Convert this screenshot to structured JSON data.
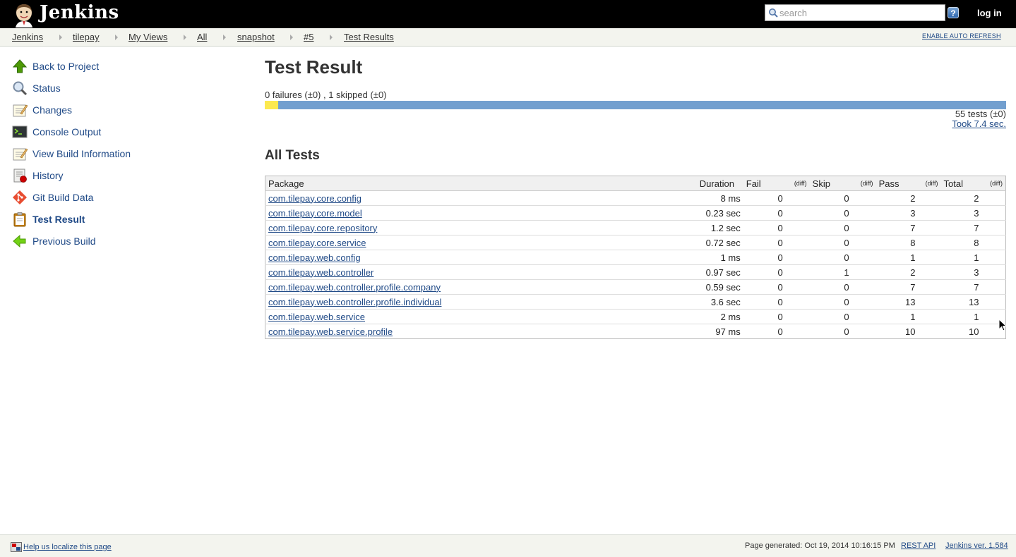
{
  "header": {
    "brand": "Jenkins",
    "search_placeholder": "search",
    "help_label": "?",
    "login_label": "log in"
  },
  "breadcrumbs": [
    "Jenkins",
    "tilepay",
    "My Views",
    "All",
    "snapshot",
    "#5",
    "Test Results"
  ],
  "auto_refresh_label": "ENABLE AUTO REFRESH",
  "side_panel": [
    {
      "label": "Back to Project",
      "icon": "up-arrow-icon"
    },
    {
      "label": "Status",
      "icon": "magnifier-icon"
    },
    {
      "label": "Changes",
      "icon": "notepad-icon"
    },
    {
      "label": "Console Output",
      "icon": "terminal-icon"
    },
    {
      "label": "View Build Information",
      "icon": "notepad-icon"
    },
    {
      "label": "History",
      "icon": "history-icon"
    },
    {
      "label": "Git Build Data",
      "icon": "git-icon"
    },
    {
      "label": "Test Result",
      "icon": "clipboard-icon"
    },
    {
      "label": "Previous Build",
      "icon": "left-arrow-icon"
    }
  ],
  "main": {
    "title": "Test Result",
    "summary": "0 failures (±0) , 1 skipped (±0)",
    "progress": {
      "total": 55,
      "failed": 0,
      "skipped": 1
    },
    "tests_count": "55 tests (±0)",
    "took": "Took 7.4 sec.",
    "all_tests_heading": "All Tests",
    "columns": {
      "package": "Package",
      "duration": "Duration",
      "fail": "Fail",
      "fail_diff": "(diff)",
      "skip": "Skip",
      "skip_diff": "(diff)",
      "pass": "Pass",
      "pass_diff": "(diff)",
      "total": "Total",
      "total_diff": "(diff)"
    },
    "rows": [
      {
        "package": "com.tilepay.core.config",
        "duration": "8 ms",
        "fail": "0",
        "skip": "0",
        "pass": "2",
        "total": "2"
      },
      {
        "package": "com.tilepay.core.model",
        "duration": "0.23 sec",
        "fail": "0",
        "skip": "0",
        "pass": "3",
        "total": "3"
      },
      {
        "package": "com.tilepay.core.repository",
        "duration": "1.2 sec",
        "fail": "0",
        "skip": "0",
        "pass": "7",
        "total": "7"
      },
      {
        "package": "com.tilepay.core.service",
        "duration": "0.72 sec",
        "fail": "0",
        "skip": "0",
        "pass": "8",
        "total": "8"
      },
      {
        "package": "com.tilepay.web.config",
        "duration": "1 ms",
        "fail": "0",
        "skip": "0",
        "pass": "1",
        "total": "1"
      },
      {
        "package": "com.tilepay.web.controller",
        "duration": "0.97 sec",
        "fail": "0",
        "skip": "1",
        "pass": "2",
        "total": "3"
      },
      {
        "package": "com.tilepay.web.controller.profile.company",
        "duration": "0.59 sec",
        "fail": "0",
        "skip": "0",
        "pass": "7",
        "total": "7"
      },
      {
        "package": "com.tilepay.web.controller.profile.individual",
        "duration": "3.6 sec",
        "fail": "0",
        "skip": "0",
        "pass": "13",
        "total": "13"
      },
      {
        "package": "com.tilepay.web.service",
        "duration": "2 ms",
        "fail": "0",
        "skip": "0",
        "pass": "1",
        "total": "1"
      },
      {
        "package": "com.tilepay.web.service.profile",
        "duration": "97 ms",
        "fail": "0",
        "skip": "0",
        "pass": "10",
        "total": "10"
      }
    ]
  },
  "footer": {
    "localize": "Help us localize this page",
    "generated": "Page generated: Oct 19, 2014 10:16:15 PM",
    "rest_api": "REST API",
    "version": "Jenkins ver. 1.584"
  },
  "colors": {
    "header_bg": "#000000",
    "link": "#204a87",
    "pass_bar": "#729fcf",
    "skip_bar": "#fce94f",
    "breadcrumb_bg": "#f3f4ee"
  }
}
